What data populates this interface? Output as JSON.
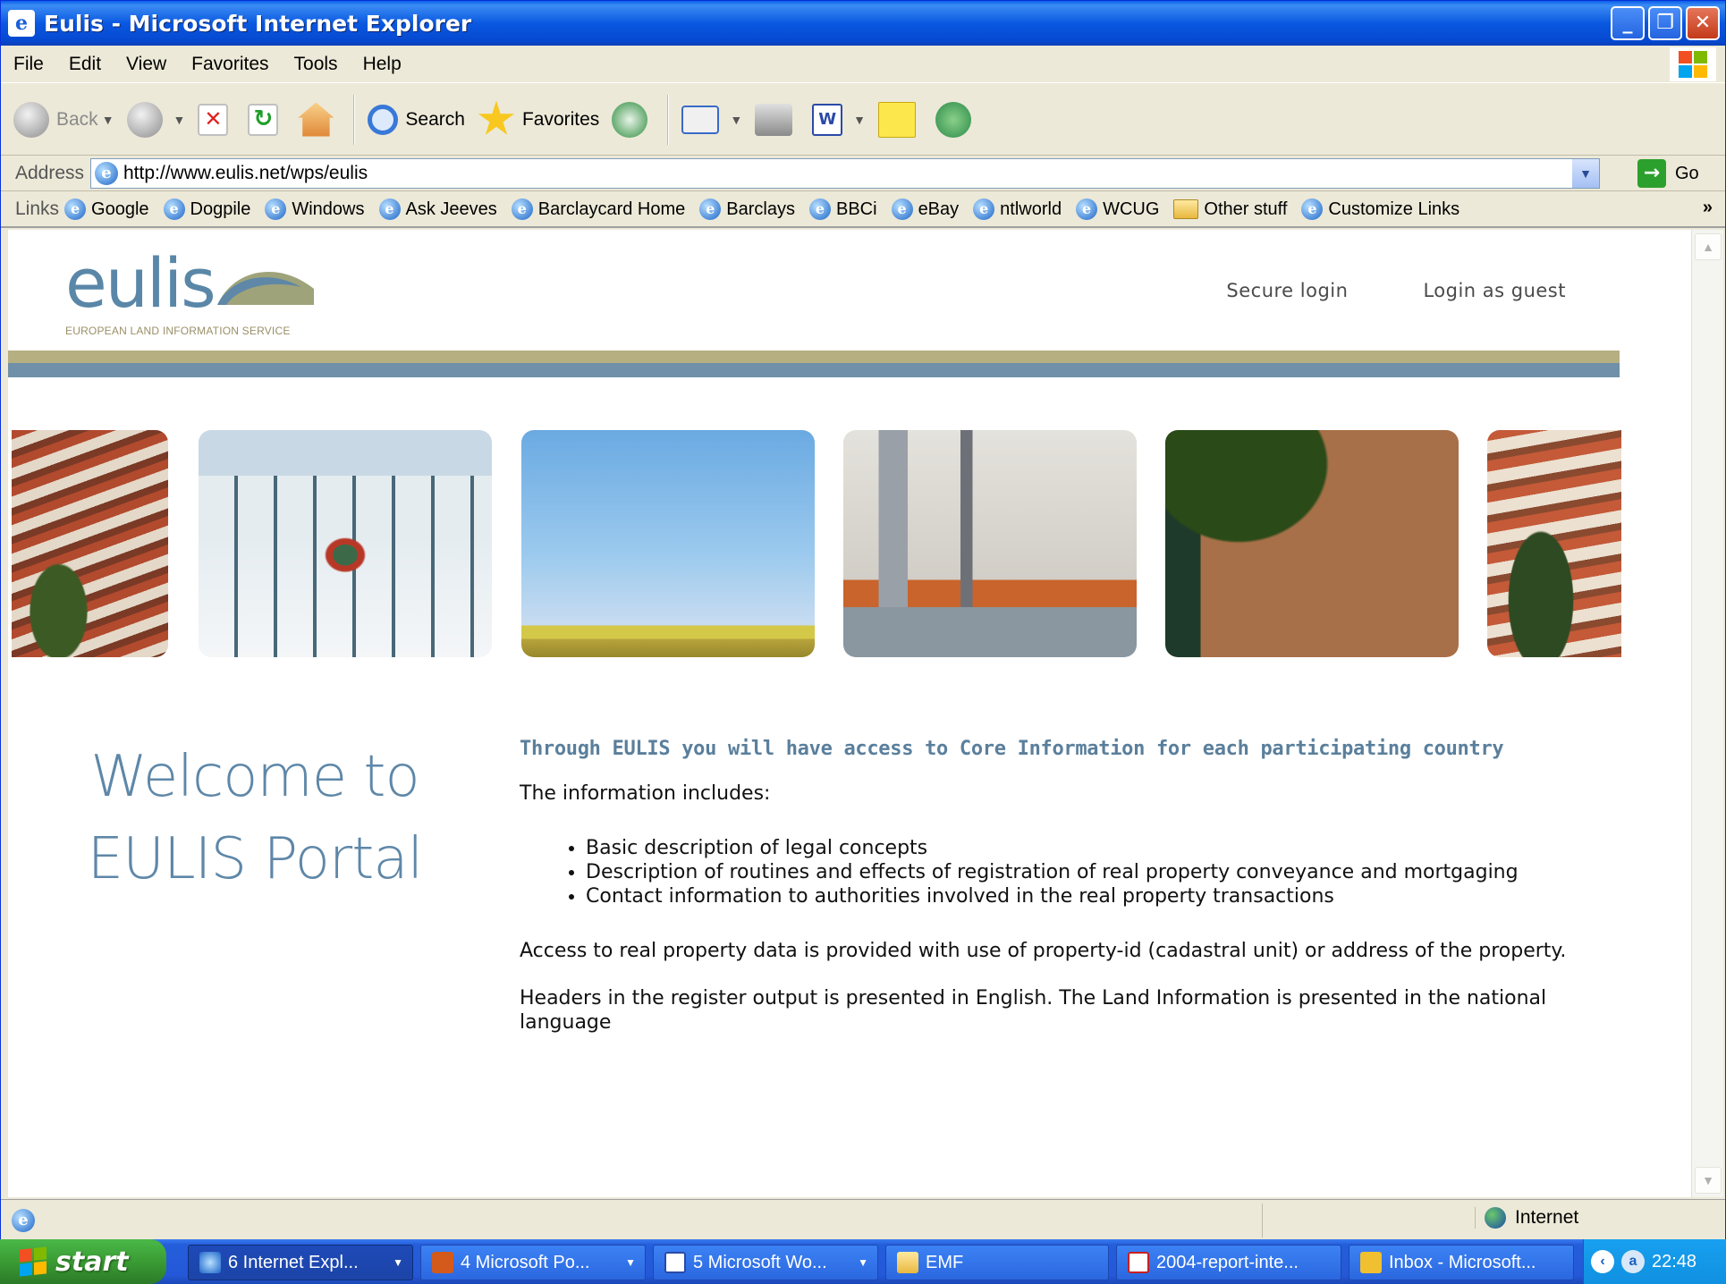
{
  "window": {
    "title": "Eulis - Microsoft Internet Explorer",
    "minimize": "_",
    "maximize": "❐",
    "close": "✕"
  },
  "menu": [
    "File",
    "Edit",
    "View",
    "Favorites",
    "Tools",
    "Help"
  ],
  "toolbar": {
    "back": "Back",
    "search": "Search",
    "favorites": "Favorites"
  },
  "address": {
    "label": "Address",
    "url": "http://www.eulis.net/wps/eulis",
    "go": "Go"
  },
  "links": {
    "label": "Links",
    "items": [
      "Google",
      "Dogpile",
      "Windows",
      "Ask Jeeves",
      "Barclaycard Home",
      "Barclays",
      "BBCi",
      "eBay",
      "ntlworld",
      "WCUG",
      "Other stuff",
      "Customize Links"
    ],
    "more": "»"
  },
  "page": {
    "logo_word": "eulis",
    "logo_tagline": "EUROPEAN LAND INFORMATION SERVICE",
    "secure_login": "Secure login",
    "guest_login": "Login as guest",
    "welcome_line1": "Welcome to",
    "welcome_line2": "EULIS Portal",
    "heading": "Through EULIS you will have access to Core Information for each participating country",
    "intro": "The information includes:",
    "bullets": [
      "Basic description of legal concepts",
      "Description of routines and effects of registration of real property conveyance and mortgaging",
      "Contact information to authorities involved in the real property transactions"
    ],
    "para1": "Access to real property data is provided with use of property-id (cadastral unit) or address of the property.",
    "para2": "Headers in the register output is presented in English. The Land Information is presented in the national language",
    "colors": {
      "brand_blue": "#5e87a8",
      "band_olive": "#b5af82",
      "band_blue": "#6f90a8"
    }
  },
  "status": {
    "zone": "Internet"
  },
  "taskbar": {
    "start": "start",
    "tasks": [
      "6 Internet Expl...",
      "4 Microsoft Po...",
      "5 Microsoft Wo...",
      "EMF",
      "2004-report-inte...",
      "Inbox - Microsoft..."
    ],
    "clock": "22:48"
  }
}
